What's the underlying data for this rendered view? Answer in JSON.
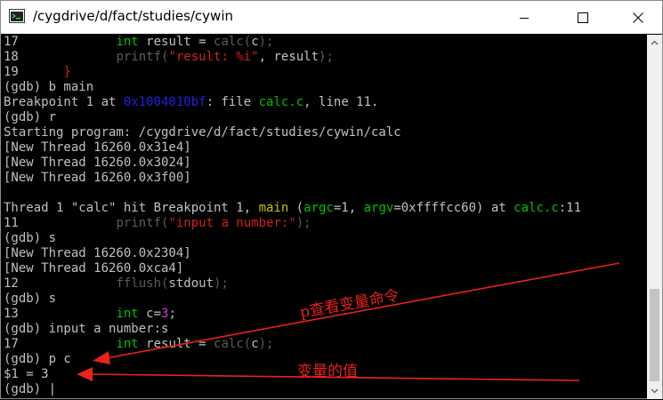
{
  "window": {
    "title": "/cygdrive/d/fact/studies/cywin"
  },
  "colors": {
    "default": "#c0c0c0",
    "keyword": "#00c000",
    "dim": "#5a5a5a",
    "string": "#d02020",
    "address": "#2020e0",
    "func": "#c0c000",
    "file": "#00c000",
    "param": "#e060e0",
    "number": "#d040d0",
    "annotation": "#e8221c"
  },
  "lines": [
    [
      {
        "t": "17             ",
        "c": "default"
      },
      {
        "t": "int",
        "c": "keyword"
      },
      {
        "t": " result = ",
        "c": "default"
      },
      {
        "t": "calc(",
        "c": "dim"
      },
      {
        "t": "c",
        "c": "default"
      },
      {
        "t": ");",
        "c": "dim"
      }
    ],
    [
      {
        "t": "18             ",
        "c": "default"
      },
      {
        "t": "printf(",
        "c": "dim"
      },
      {
        "t": "\"result: %i\"",
        "c": "string"
      },
      {
        "t": ", result",
        "c": "default"
      },
      {
        "t": ");",
        "c": "dim"
      }
    ],
    [
      {
        "t": "19      ",
        "c": "default"
      },
      {
        "t": "}",
        "c": "string"
      }
    ],
    [
      {
        "t": "(gdb) b main",
        "c": "default"
      }
    ],
    [
      {
        "t": "Breakpoint 1 at ",
        "c": "default"
      },
      {
        "t": "0x1004010bf",
        "c": "address"
      },
      {
        "t": ": file ",
        "c": "default"
      },
      {
        "t": "calc.c",
        "c": "file"
      },
      {
        "t": ", line 11.",
        "c": "default"
      }
    ],
    [
      {
        "t": "(gdb) r",
        "c": "default"
      }
    ],
    [
      {
        "t": "Starting program: /cygdrive/d/fact/studies/cywin/calc",
        "c": "default"
      }
    ],
    [
      {
        "t": "[New Thread 16260.0x31e4]",
        "c": "default"
      }
    ],
    [
      {
        "t": "[New Thread 16260.0x3024]",
        "c": "default"
      }
    ],
    [
      {
        "t": "[New Thread 16260.0x3f00]",
        "c": "default"
      }
    ],
    [
      {
        "t": "",
        "c": "default"
      }
    ],
    [
      {
        "t": "Thread 1 \"calc\" hit Breakpoint 1, ",
        "c": "default"
      },
      {
        "t": "main",
        "c": "func"
      },
      {
        "t": " (",
        "c": "default"
      },
      {
        "t": "argc",
        "c": "file"
      },
      {
        "t": "=1, ",
        "c": "default"
      },
      {
        "t": "argv",
        "c": "file"
      },
      {
        "t": "=0xffffcc60) at ",
        "c": "default"
      },
      {
        "t": "calc.c",
        "c": "file"
      },
      {
        "t": ":11",
        "c": "default"
      }
    ],
    [
      {
        "t": "11             ",
        "c": "default"
      },
      {
        "t": "printf(",
        "c": "dim"
      },
      {
        "t": "\"input a number:\"",
        "c": "string"
      },
      {
        "t": ");",
        "c": "dim"
      }
    ],
    [
      {
        "t": "(gdb) s",
        "c": "default"
      }
    ],
    [
      {
        "t": "[New Thread 16260.0x2304]",
        "c": "default"
      }
    ],
    [
      {
        "t": "[New Thread 16260.0xca4]",
        "c": "default"
      }
    ],
    [
      {
        "t": "12             ",
        "c": "default"
      },
      {
        "t": "fflush(",
        "c": "dim"
      },
      {
        "t": "stdout",
        "c": "default"
      },
      {
        "t": ");",
        "c": "dim"
      }
    ],
    [
      {
        "t": "(gdb) s",
        "c": "default"
      }
    ],
    [
      {
        "t": "13             ",
        "c": "default"
      },
      {
        "t": "int",
        "c": "keyword"
      },
      {
        "t": " c=",
        "c": "default"
      },
      {
        "t": "3",
        "c": "number"
      },
      {
        "t": ";",
        "c": "default"
      }
    ],
    [
      {
        "t": "(gdb) input a number:s",
        "c": "default"
      }
    ],
    [
      {
        "t": "17             ",
        "c": "default"
      },
      {
        "t": "int",
        "c": "keyword"
      },
      {
        "t": " result = ",
        "c": "default"
      },
      {
        "t": "calc(",
        "c": "dim"
      },
      {
        "t": "c",
        "c": "default"
      },
      {
        "t": ");",
        "c": "dim"
      }
    ],
    [
      {
        "t": "(gdb) p c",
        "c": "default"
      }
    ],
    [
      {
        "t": "$1 = 3",
        "c": "default"
      }
    ],
    [
      {
        "t": "(gdb) |",
        "c": "default"
      }
    ]
  ],
  "annotations": {
    "label1": "p查看变量命令",
    "label2": "变量的值"
  }
}
